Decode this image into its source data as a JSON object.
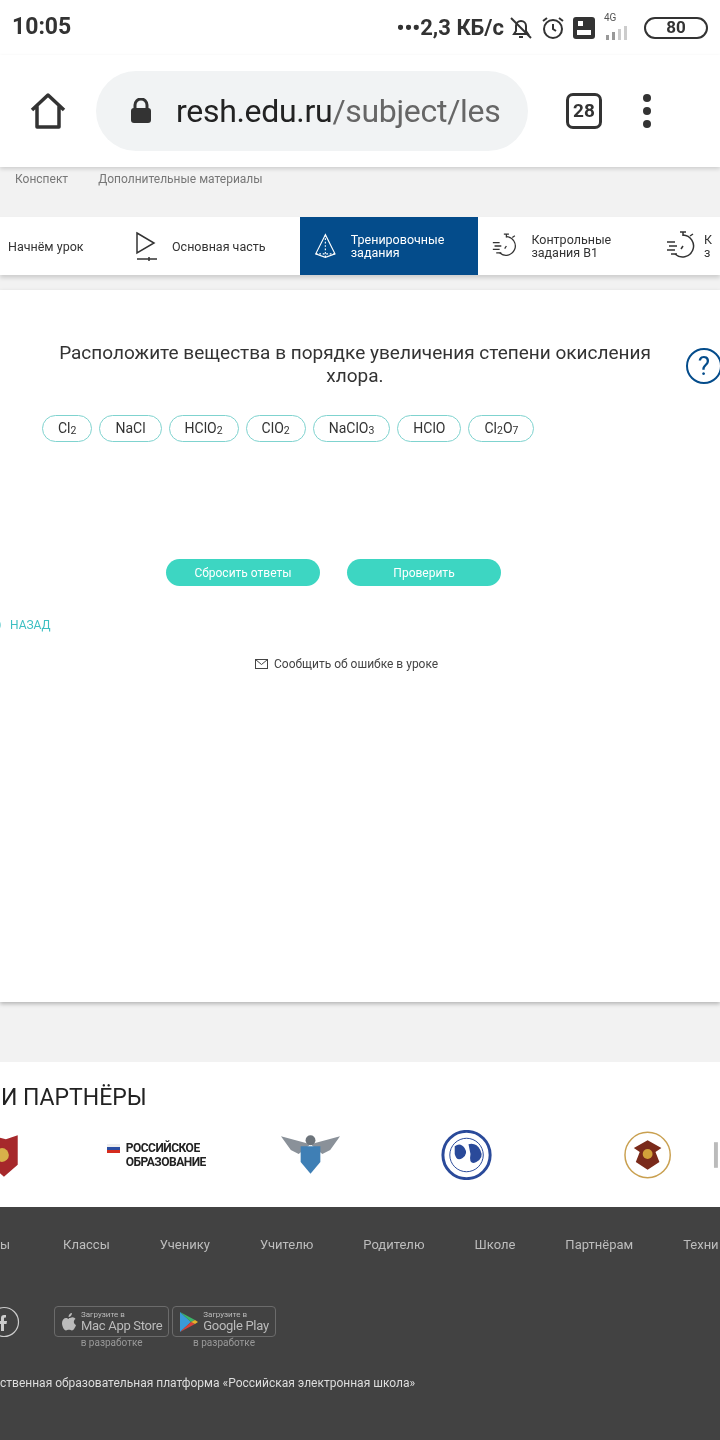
{
  "status_bar": {
    "time": "10:05",
    "speed": "•••2,3 КБ/с",
    "network": "4G",
    "battery": "80"
  },
  "browser": {
    "url_host": "resh.edu.ru",
    "url_path": "/subject/les",
    "tab_count": "28"
  },
  "lesson_links": [
    "Конспект",
    "Дополнительные материалы"
  ],
  "tabs": [
    {
      "label": "Начнём урок",
      "kind": "plain",
      "selected": false
    },
    {
      "label": "Основная часть",
      "kind": "play",
      "selected": false
    },
    {
      "label": "Тренировочные задания",
      "kind": "pyramid",
      "selected": true
    },
    {
      "label": "Контрольные задания В1",
      "kind": "timer",
      "selected": false
    },
    {
      "label": "К\nз",
      "kind": "timer",
      "selected": false
    }
  ],
  "task": {
    "question": "Расположите вещества в порядке увеличения степени окисления хлора.",
    "help": "?",
    "chips": [
      "Cl$_{2}$",
      "NaCl",
      "HClO$_{2}$",
      "ClO$_{2}$",
      "NaClO$_{3}$",
      "HClO",
      "Cl$_{2}$O$_{7}$"
    ],
    "buttons": [
      "Сбросить ответы",
      "Проверить"
    ]
  },
  "back_link": "НАЗАД",
  "report_link": "Сообщить об ошибке в уроке",
  "partners": {
    "title": "И ПАРТНЁРЫ",
    "logo_text": "РОССИЙСКОЕ\nОБРАЗОВАНИЕ"
  },
  "footer": {
    "links": [
      "ы",
      "Классы",
      "Ученику",
      "Учителю",
      "Родителю",
      "Школе",
      "Партнёрам",
      "Техни"
    ],
    "stores": [
      {
        "small": "Загрузите в",
        "name": "Mac App Store",
        "kind": "apple",
        "note": "в разработке"
      },
      {
        "small": "Загрузите в",
        "name": "Google Play",
        "kind": "play",
        "note": "в разработке"
      }
    ],
    "copyright": "ственная образовательная платформа «Российская электронная школа»"
  }
}
